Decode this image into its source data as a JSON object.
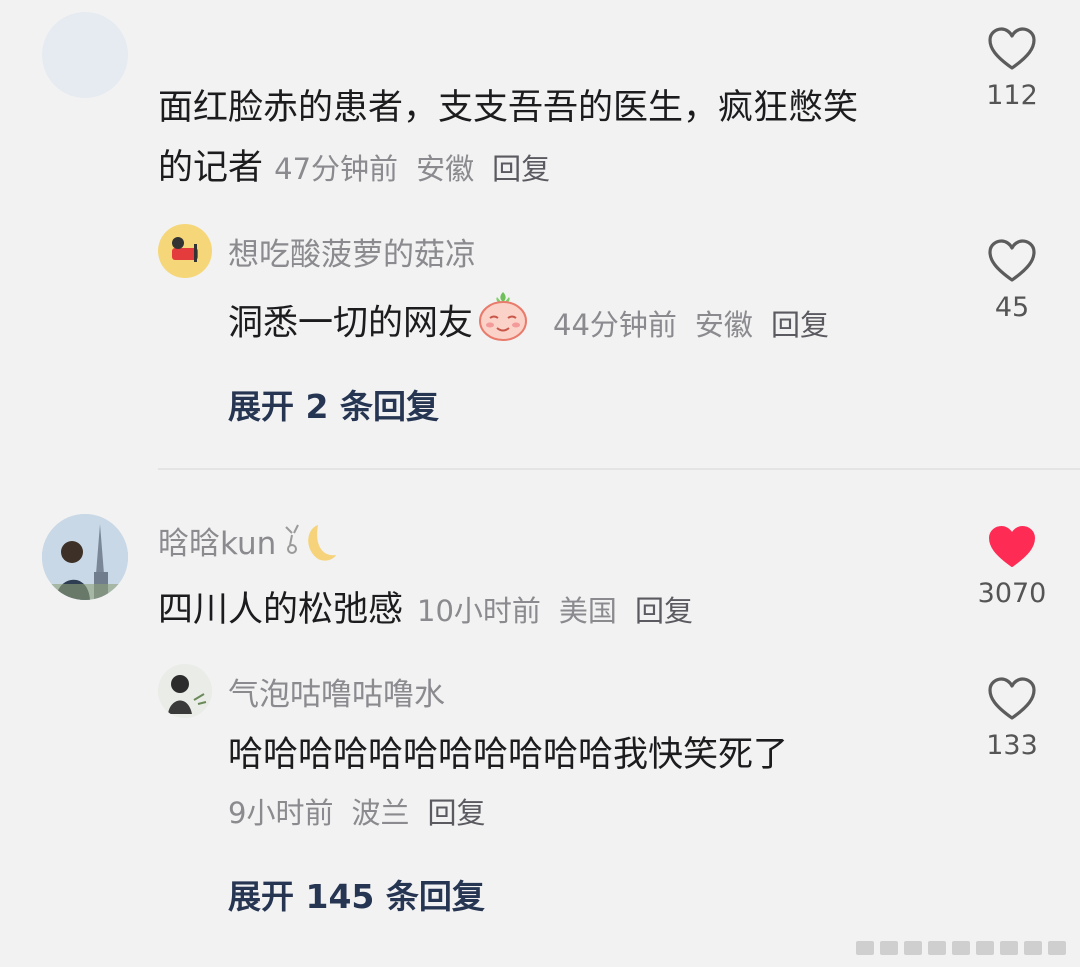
{
  "comments": [
    {
      "text": "面红脸赤的患者，支支吾吾的医生，疯狂憋笑的记者",
      "text_line1": "面红脸赤的患者，支支吾吾的医生，疯狂憋笑",
      "text_line2": "的记者",
      "time": "47分钟前",
      "location": "安徽",
      "reply_label": "回复",
      "likes": "112",
      "liked": false,
      "reply": {
        "username": "想吃酸菠萝的菇凉",
        "text": "洞悉一切的网友",
        "time": "44分钟前",
        "location": "安徽",
        "reply_label": "回复",
        "likes": "45",
        "liked": false
      },
      "expand_label": "展开 2 条回复"
    },
    {
      "username": "晗晗kun",
      "text": "四川人的松弛感",
      "time": "10小时前",
      "location": "美国",
      "reply_label": "回复",
      "likes": "3070",
      "liked": true,
      "reply": {
        "username": "气泡咕噜咕噜水",
        "text": "哈哈哈哈哈哈哈哈哈哈哈我快笑死了",
        "time": "9小时前",
        "location": "波兰",
        "reply_label": "回复",
        "likes": "133",
        "liked": false
      },
      "expand_label": "展开 145 条回复"
    }
  ],
  "colors": {
    "background": "#f2f2f2",
    "liked_heart": "#fe2c55",
    "expand_link": "#253552"
  },
  "icons": {
    "like": "heart-outline-icon",
    "liked": "heart-filled-icon",
    "emoji": "pineapple-emoji-icon",
    "username_decoration": "moon-icon"
  }
}
